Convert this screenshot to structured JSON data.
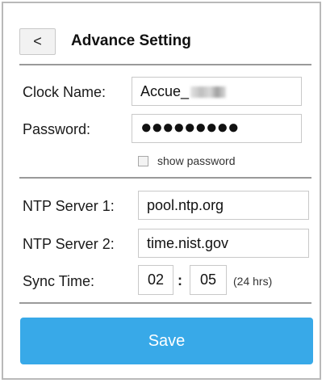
{
  "header": {
    "back_label": "<",
    "title": "Advance Setting"
  },
  "account": {
    "clock_name_label": "Clock Name:",
    "clock_name_value": "Accue_",
    "password_label": "Password:",
    "password_value": "●●●●●●●●●",
    "show_password_label": "show password",
    "show_password_checked": false
  },
  "ntp": {
    "server1_label": "NTP Server 1:",
    "server1_value": "pool.ntp.org",
    "server2_label": "NTP Server 2:",
    "server2_value": "time.nist.gov",
    "sync_time_label": "Sync Time:",
    "sync_hour": "02",
    "sync_separator": ":",
    "sync_minute": "05",
    "sync_hint": "(24 hrs)"
  },
  "footer": {
    "save_label": "Save"
  },
  "colors": {
    "save_button": "#38a9e8",
    "divider": "#9a9a9a",
    "field_border": "#c9c9c9"
  }
}
